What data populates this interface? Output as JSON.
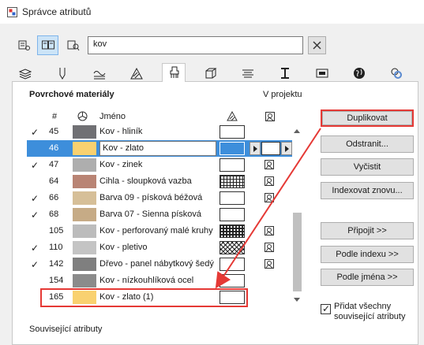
{
  "window": {
    "title": "Správce atributů"
  },
  "search": {
    "value": "kov",
    "placeholder": ""
  },
  "tabs": [
    "layers-icon",
    "pen-icon",
    "line-types-icon",
    "fill-icon",
    "surface-icon",
    "composite-icon",
    "profile-icon",
    "zone-icon",
    "markup-icon",
    "globe-icon",
    "operation-profile-icon"
  ],
  "section": {
    "title": "Povrchové materiály",
    "in_project": "V projektu"
  },
  "columns": {
    "num": "#",
    "name": "Jméno"
  },
  "rows": [
    {
      "checked": true,
      "num": "45",
      "name": "Kov - hliník",
      "color": "#707074",
      "pattern": "none",
      "in_project": false
    },
    {
      "checked": false,
      "num": "46",
      "name": "Kov - zlato",
      "color": "#f9d170",
      "pattern": "none",
      "in_project": false,
      "selected": true
    },
    {
      "checked": true,
      "num": "47",
      "name": "Kov - zinek",
      "color": "#aeaeae",
      "pattern": "none",
      "in_project": true
    },
    {
      "checked": false,
      "num": "64",
      "name": "Cihla - sloupková vazba",
      "color": "#b98474",
      "pattern": "grid",
      "in_project": true
    },
    {
      "checked": true,
      "num": "66",
      "name": "Barva 09 - písková béžová",
      "color": "#d6bf98",
      "pattern": "none",
      "in_project": true
    },
    {
      "checked": true,
      "num": "68",
      "name": "Barva 07 - Sienna písková",
      "color": "#c6ab86",
      "pattern": "none",
      "in_project": false
    },
    {
      "checked": false,
      "num": "105",
      "name": "Kov - perforovaný malé kruhy",
      "color": "#bcbcbc",
      "pattern": "dots",
      "in_project": true
    },
    {
      "checked": true,
      "num": "110",
      "name": "Kov - pletivo",
      "color": "#c4c4c4",
      "pattern": "mesh",
      "in_project": true
    },
    {
      "checked": true,
      "num": "142",
      "name": "Dřevo - panel nábytkový šedý",
      "color": "#7f7f7f",
      "pattern": "none",
      "in_project": true
    },
    {
      "checked": false,
      "num": "154",
      "name": "Kov - nízkouhlíková ocel",
      "color": "#8b8b8b",
      "pattern": "none",
      "in_project": false
    },
    {
      "checked": false,
      "num": "165",
      "name": "Kov - zlato (1)",
      "color": "#f9d170",
      "pattern": "none",
      "in_project": false
    }
  ],
  "buttons": {
    "duplicate": "Duplikovat",
    "remove": "Odstranit...",
    "purge": "Vyčistit",
    "reindex": "Indexovat znovu...",
    "append": "Připojit >>",
    "by_index": "Podle indexu >>",
    "by_name": "Podle jména >>"
  },
  "add_related": {
    "label": "Přidat všechny související atributy",
    "checked": true
  },
  "related": {
    "title": "Související atributy"
  },
  "colors": {
    "highlight": "#e53935",
    "selection": "#3d8edb"
  }
}
